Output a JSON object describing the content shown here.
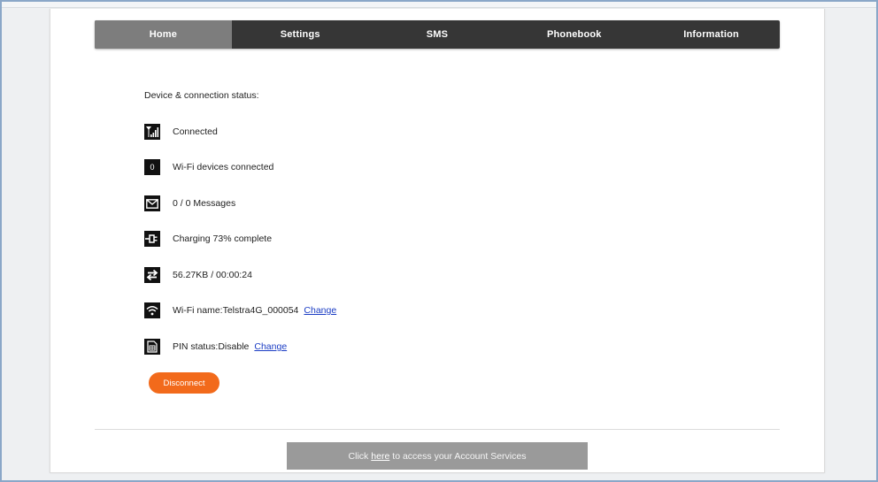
{
  "nav": {
    "items": [
      {
        "label": "Home"
      },
      {
        "label": "Settings"
      },
      {
        "label": "SMS"
      },
      {
        "label": "Phonebook"
      },
      {
        "label": "Information"
      }
    ],
    "active": "Home"
  },
  "status": {
    "title": "Device & connection status:",
    "signal": "Connected",
    "wifi_devices_count": "0",
    "wifi_devices_label": "Wi-Fi devices connected",
    "messages": "0 / 0 Messages",
    "charging": "Charging 73% complete",
    "data_usage": "56.27KB / 00:00:24",
    "wifi_name": "Wi-Fi name:Telstra4G_000054",
    "wifi_change": "Change",
    "pin_status": "PIN status:Disable",
    "pin_change": "Change"
  },
  "actions": {
    "disconnect_label": "Disconnect"
  },
  "footer": {
    "prefix": "Click",
    "link": "here",
    "suffix": "to access your Account Services"
  },
  "colors": {
    "accent": "#f26a1b",
    "nav_bg": "#363636",
    "nav_active": "#7d7d7d",
    "link": "#1a3cc4"
  }
}
